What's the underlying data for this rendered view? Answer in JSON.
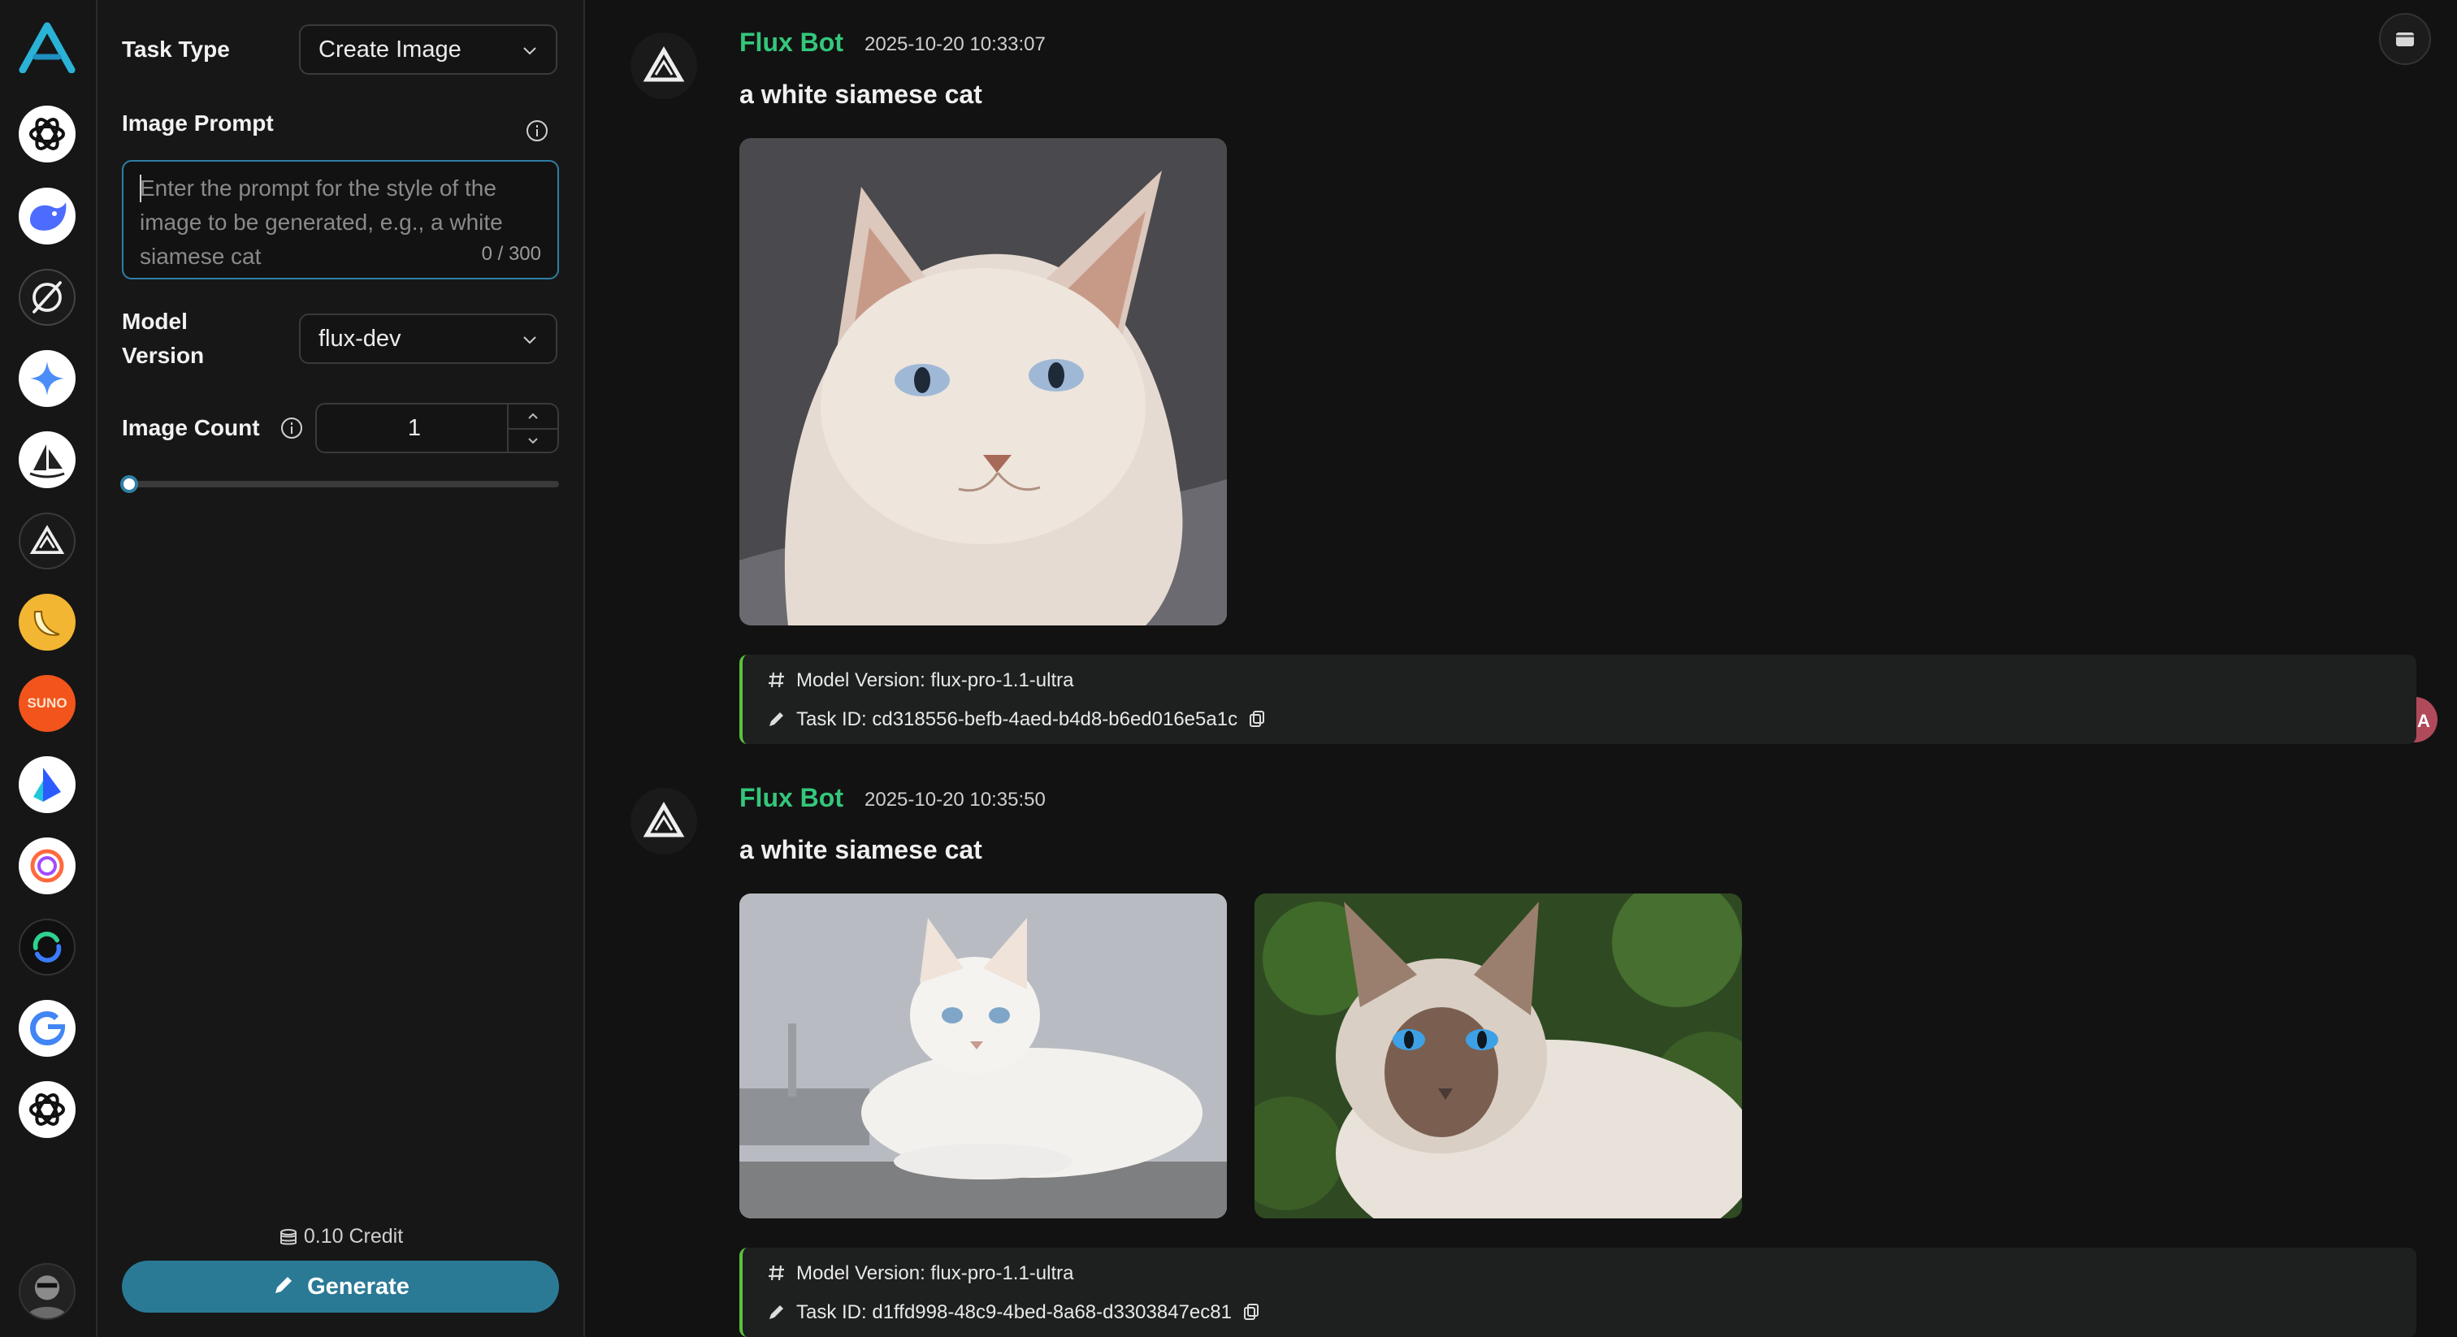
{
  "rail": {
    "items": [
      {
        "name": "chatgpt"
      },
      {
        "name": "deepseek"
      },
      {
        "name": "ideogram"
      },
      {
        "name": "gemini"
      },
      {
        "name": "midjourney"
      },
      {
        "name": "flux"
      },
      {
        "name": "banana"
      },
      {
        "name": "suno",
        "label": "SUNO"
      },
      {
        "name": "kling"
      },
      {
        "name": "pika"
      },
      {
        "name": "luma"
      },
      {
        "name": "google"
      },
      {
        "name": "openai"
      }
    ]
  },
  "panel": {
    "task_type_label": "Task Type",
    "task_type_value": "Create Image",
    "image_prompt_label": "Image Prompt",
    "prompt_placeholder": "Enter the prompt for the style of the image to be generated, e.g., a white siamese cat",
    "prompt_counter": "0 / 300",
    "model_version_label": "Model Version",
    "model_version_value": "flux-dev",
    "image_count_label": "Image Count",
    "image_count_value": "1",
    "slider_fraction": 0.0,
    "credit": "0.10 Credit",
    "generate_label": "Generate"
  },
  "chat": {
    "messages": [
      {
        "bot_name": "Flux Bot",
        "timestamp": "2025-10-20 10:33:07",
        "prompt": "a white siamese cat",
        "model_version": "Model Version: flux-pro-1.1-ultra",
        "task_id": "Task ID: cd318556-befb-4aed-b4d8-b6ed016e5a1c"
      },
      {
        "bot_name": "Flux Bot",
        "timestamp": "2025-10-20 10:35:50",
        "prompt": "a white siamese cat",
        "model_version": "Model Version: flux-pro-1.1-ultra",
        "task_id": "Task ID: d1ffd998-48c9-4bed-8a68-d3303847ec81"
      }
    ],
    "translate_label": "中A"
  },
  "colors": {
    "accent": "#2a7a96",
    "bot_name": "#34c77b",
    "meta_border": "#5bc23d",
    "focus_border": "#2f7fa5"
  }
}
